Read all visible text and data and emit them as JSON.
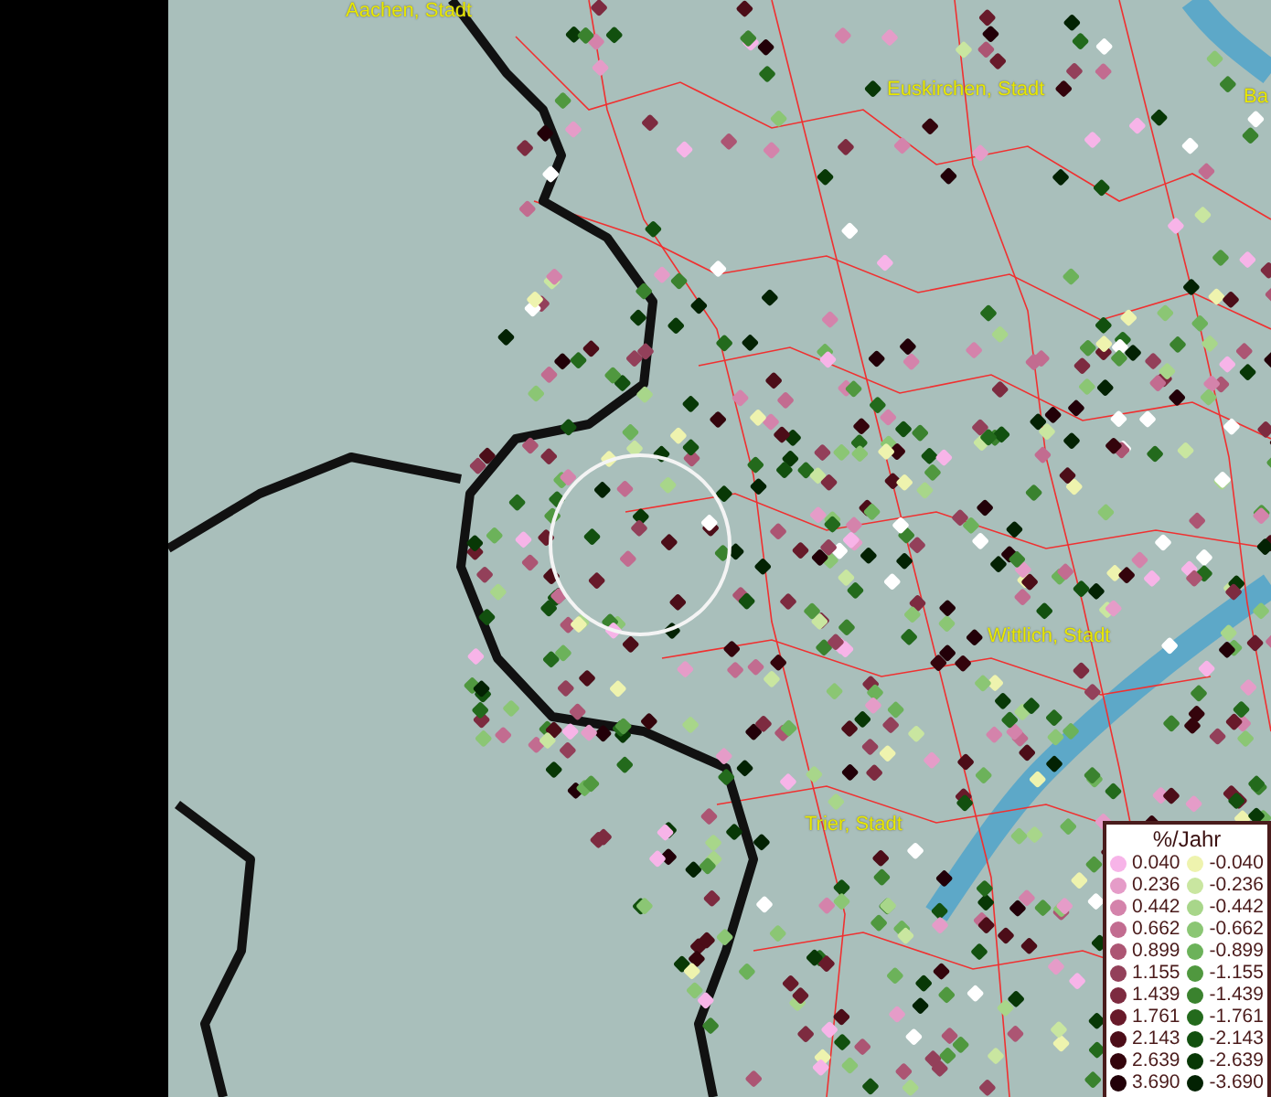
{
  "map": {
    "places": [
      {
        "name": "Aachen, Stadt"
      },
      {
        "name": "Euskirchen, Stadt"
      },
      {
        "name": "Ba"
      },
      {
        "name": "Wittlich, Stadt"
      },
      {
        "name": "Trier, Stadt"
      }
    ]
  },
  "legend": {
    "title": "%/Jahr",
    "items": [
      {
        "label": "0.040",
        "color": "#f7b4e8"
      },
      {
        "label": "0.236",
        "color": "#e59cc8"
      },
      {
        "label": "0.442",
        "color": "#d483ab"
      },
      {
        "label": "0.662",
        "color": "#c26c90"
      },
      {
        "label": "0.899",
        "color": "#ac5573"
      },
      {
        "label": "1.155",
        "color": "#93405a"
      },
      {
        "label": "1.439",
        "color": "#7d2b40"
      },
      {
        "label": "1.761",
        "color": "#681a2a"
      },
      {
        "label": "2.143",
        "color": "#4c0d18"
      },
      {
        "label": "2.639",
        "color": "#34040c"
      },
      {
        "label": "3.690",
        "color": "#220008"
      },
      {
        "label": "-0.040",
        "color": "#eef3ae"
      },
      {
        "label": "-0.236",
        "color": "#c9e6a0"
      },
      {
        "label": "-0.442",
        "color": "#a8d68a"
      },
      {
        "label": "-0.662",
        "color": "#8bc674"
      },
      {
        "label": "-0.899",
        "color": "#6cb25a"
      },
      {
        "label": "-1.155",
        "color": "#50983f"
      },
      {
        "label": "-1.439",
        "color": "#3a822e"
      },
      {
        "label": "-1.761",
        "color": "#236a1c"
      },
      {
        "label": "-2.143",
        "color": "#12500f"
      },
      {
        "label": "-2.639",
        "color": "#083806"
      },
      {
        "label": "-3.690",
        "color": "#032203"
      }
    ]
  }
}
